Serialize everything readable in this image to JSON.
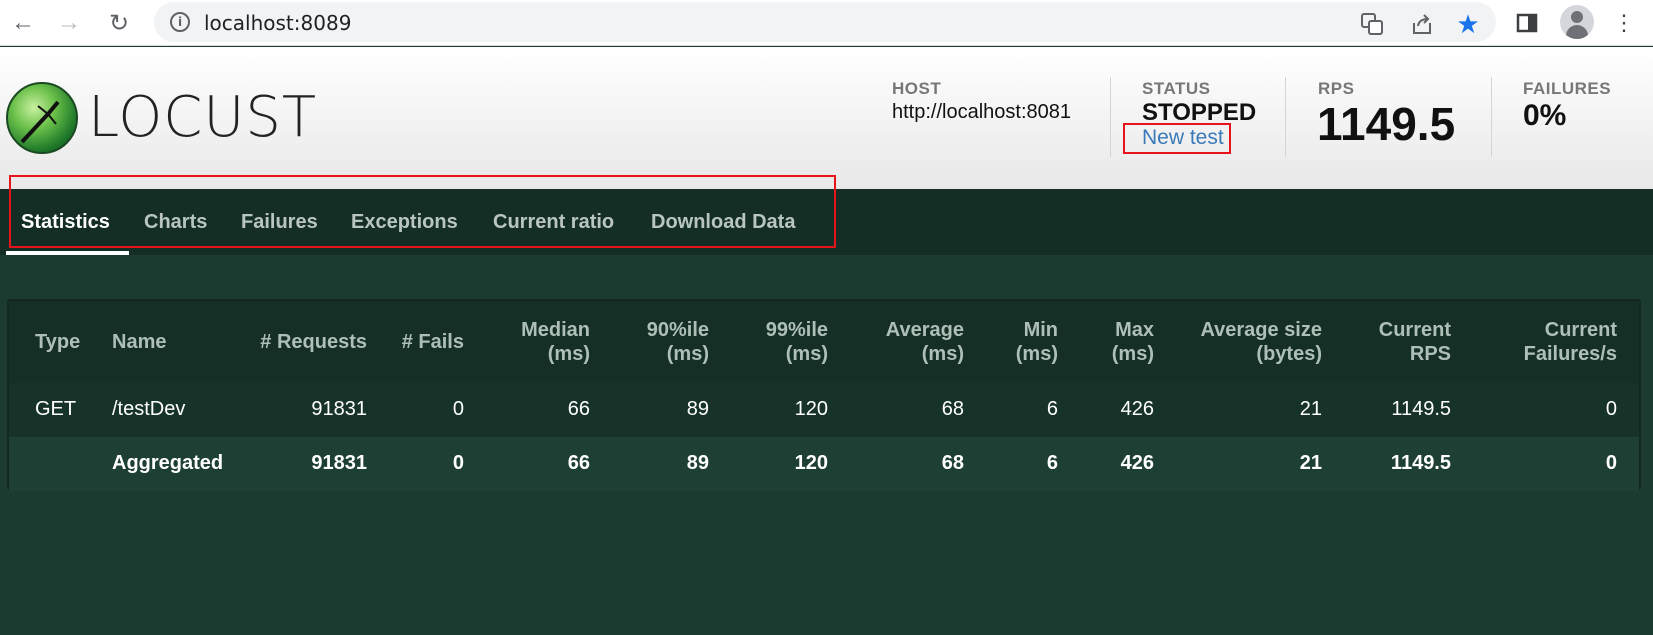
{
  "browser": {
    "url": "localhost:8089"
  },
  "header": {
    "logo_text": "LOCUST",
    "host_label": "HOST",
    "host_value": "http://localhost:8081",
    "status_label": "STATUS",
    "status_value": "STOPPED",
    "new_test_label": "New test",
    "rps_label": "RPS",
    "rps_value": "1149.5",
    "failures_label": "FAILURES",
    "failures_value": "0%"
  },
  "tabs": [
    {
      "label": "Statistics",
      "active": true
    },
    {
      "label": "Charts"
    },
    {
      "label": "Failures"
    },
    {
      "label": "Exceptions"
    },
    {
      "label": "Current ratio"
    },
    {
      "label": "Download Data"
    }
  ],
  "table": {
    "columns": [
      [
        "Type"
      ],
      [
        "Name"
      ],
      [
        "# Requests"
      ],
      [
        "# Fails"
      ],
      [
        "Median",
        "(ms)"
      ],
      [
        "90%ile",
        "(ms)"
      ],
      [
        "99%ile",
        "(ms)"
      ],
      [
        "Average",
        "(ms)"
      ],
      [
        "Min",
        "(ms)"
      ],
      [
        "Max",
        "(ms)"
      ],
      [
        "Average size",
        "(bytes)"
      ],
      [
        "Current",
        "RPS"
      ],
      [
        "Current",
        "Failures/s"
      ]
    ],
    "rows": [
      [
        "GET",
        "/testDev",
        "91831",
        "0",
        "66",
        "89",
        "120",
        "68",
        "6",
        "426",
        "21",
        "1149.5",
        "0"
      ],
      [
        "",
        "Aggregated",
        "91831",
        "0",
        "66",
        "89",
        "120",
        "68",
        "6",
        "426",
        "21",
        "1149.5",
        "0"
      ]
    ]
  },
  "colors": {
    "accent_link": "#3b7ab8",
    "annotation": "#e8141c",
    "page_bg": "#1b3a30"
  }
}
